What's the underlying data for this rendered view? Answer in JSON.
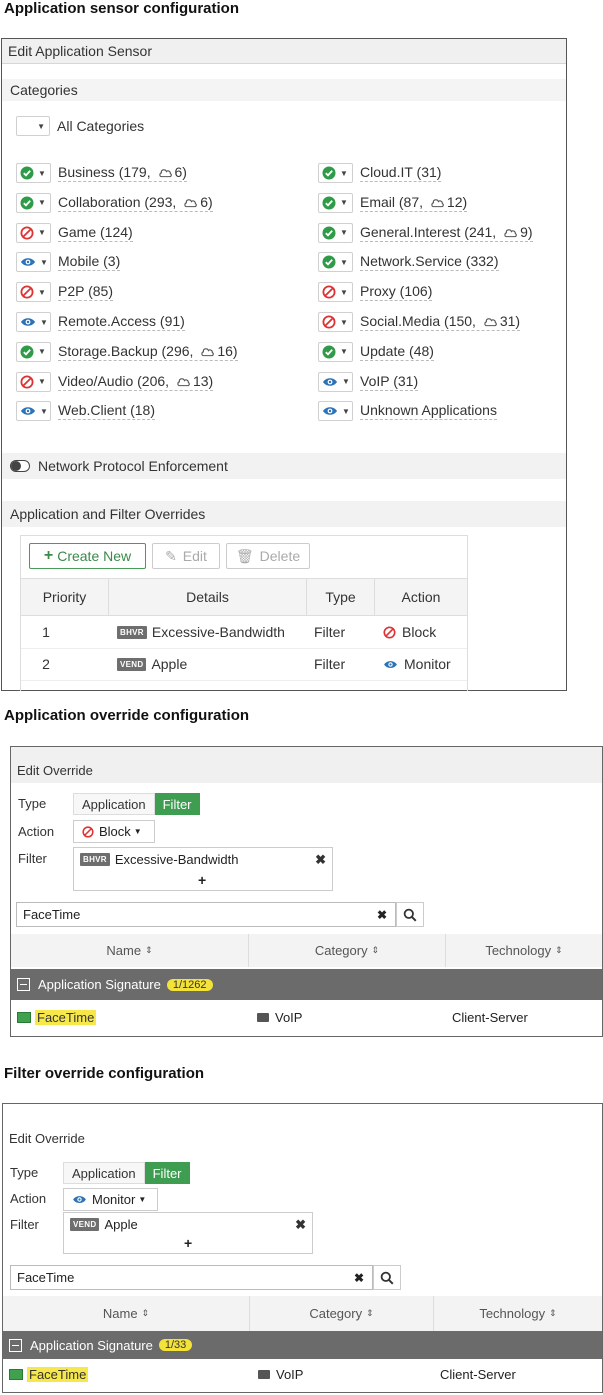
{
  "sections": {
    "sensor_title": "Application sensor configuration",
    "app_override_title": "Application override configuration",
    "filter_override_title": "Filter override configuration"
  },
  "sensor": {
    "panel_title": "Edit Application Sensor",
    "categories_header": "Categories",
    "all_categories": "All Categories",
    "left_categories": [
      {
        "name": "Business (179,",
        "cloud": "6)",
        "status": "allow"
      },
      {
        "name": "Collaboration (293,",
        "cloud": "6)",
        "status": "allow"
      },
      {
        "name": "Game (124)",
        "cloud": "",
        "status": "block"
      },
      {
        "name": "Mobile (3)",
        "cloud": "",
        "status": "monitor"
      },
      {
        "name": "P2P (85)",
        "cloud": "",
        "status": "block"
      },
      {
        "name": "Remote.Access (91)",
        "cloud": "",
        "status": "monitor"
      },
      {
        "name": "Storage.Backup (296,",
        "cloud": "16)",
        "status": "allow"
      },
      {
        "name": "Video/Audio (206,",
        "cloud": "13)",
        "status": "block"
      },
      {
        "name": "Web.Client (18)",
        "cloud": "",
        "status": "monitor"
      }
    ],
    "right_categories": [
      {
        "name": "Cloud.IT (31)",
        "cloud": "",
        "status": "allow"
      },
      {
        "name": "Email (87,",
        "cloud": "12)",
        "status": "allow"
      },
      {
        "name": "General.Interest (241,",
        "cloud": "9)",
        "status": "allow"
      },
      {
        "name": "Network.Service (332)",
        "cloud": "",
        "status": "allow"
      },
      {
        "name": "Proxy (106)",
        "cloud": "",
        "status": "block"
      },
      {
        "name": "Social.Media (150,",
        "cloud": "31)",
        "status": "block"
      },
      {
        "name": "Update (48)",
        "cloud": "",
        "status": "allow"
      },
      {
        "name": "VoIP (31)",
        "cloud": "",
        "status": "monitor"
      },
      {
        "name": "Unknown Applications",
        "cloud": "",
        "status": "monitor"
      }
    ],
    "protocol_enforcement": "Network Protocol Enforcement",
    "overrides_header": "Application and Filter Overrides",
    "toolbar": {
      "create": "Create New",
      "edit": "Edit",
      "delete": "Delete"
    },
    "table_headers": {
      "priority": "Priority",
      "details": "Details",
      "type": "Type",
      "action": "Action"
    },
    "rows": [
      {
        "priority": "1",
        "tag": "BHVR",
        "details": "Excessive-Bandwidth",
        "type": "Filter",
        "action": "Block"
      },
      {
        "priority": "2",
        "tag": "VEND",
        "details": "Apple",
        "type": "Filter",
        "action": "Monitor"
      }
    ]
  },
  "app_override": {
    "panel_title": "Edit Override",
    "type_label": "Type",
    "type_application": "Application",
    "type_filter": "Filter",
    "action_label": "Action",
    "action_value": "Block",
    "filter_label": "Filter",
    "filter_tag": "BHVR",
    "filter_value": "Excessive-Bandwidth",
    "search_value": "FaceTime",
    "col_name": "Name",
    "col_category": "Category",
    "col_technology": "Technology",
    "group_label": "Application Signature",
    "group_count": "1/1262",
    "result_name": "FaceTime",
    "result_category": "VoIP",
    "result_technology": "Client-Server"
  },
  "filter_override": {
    "panel_title": "Edit Override",
    "type_label": "Type",
    "type_application": "Application",
    "type_filter": "Filter",
    "action_label": "Action",
    "action_value": "Monitor",
    "filter_label": "Filter",
    "filter_tag": "VEND",
    "filter_value": "Apple",
    "search_value": "FaceTime",
    "col_name": "Name",
    "col_category": "Category",
    "col_technology": "Technology",
    "group_label": "Application Signature",
    "group_count": "1/33",
    "result_name": "FaceTime",
    "result_category": "VoIP",
    "result_technology": "Client-Server"
  }
}
